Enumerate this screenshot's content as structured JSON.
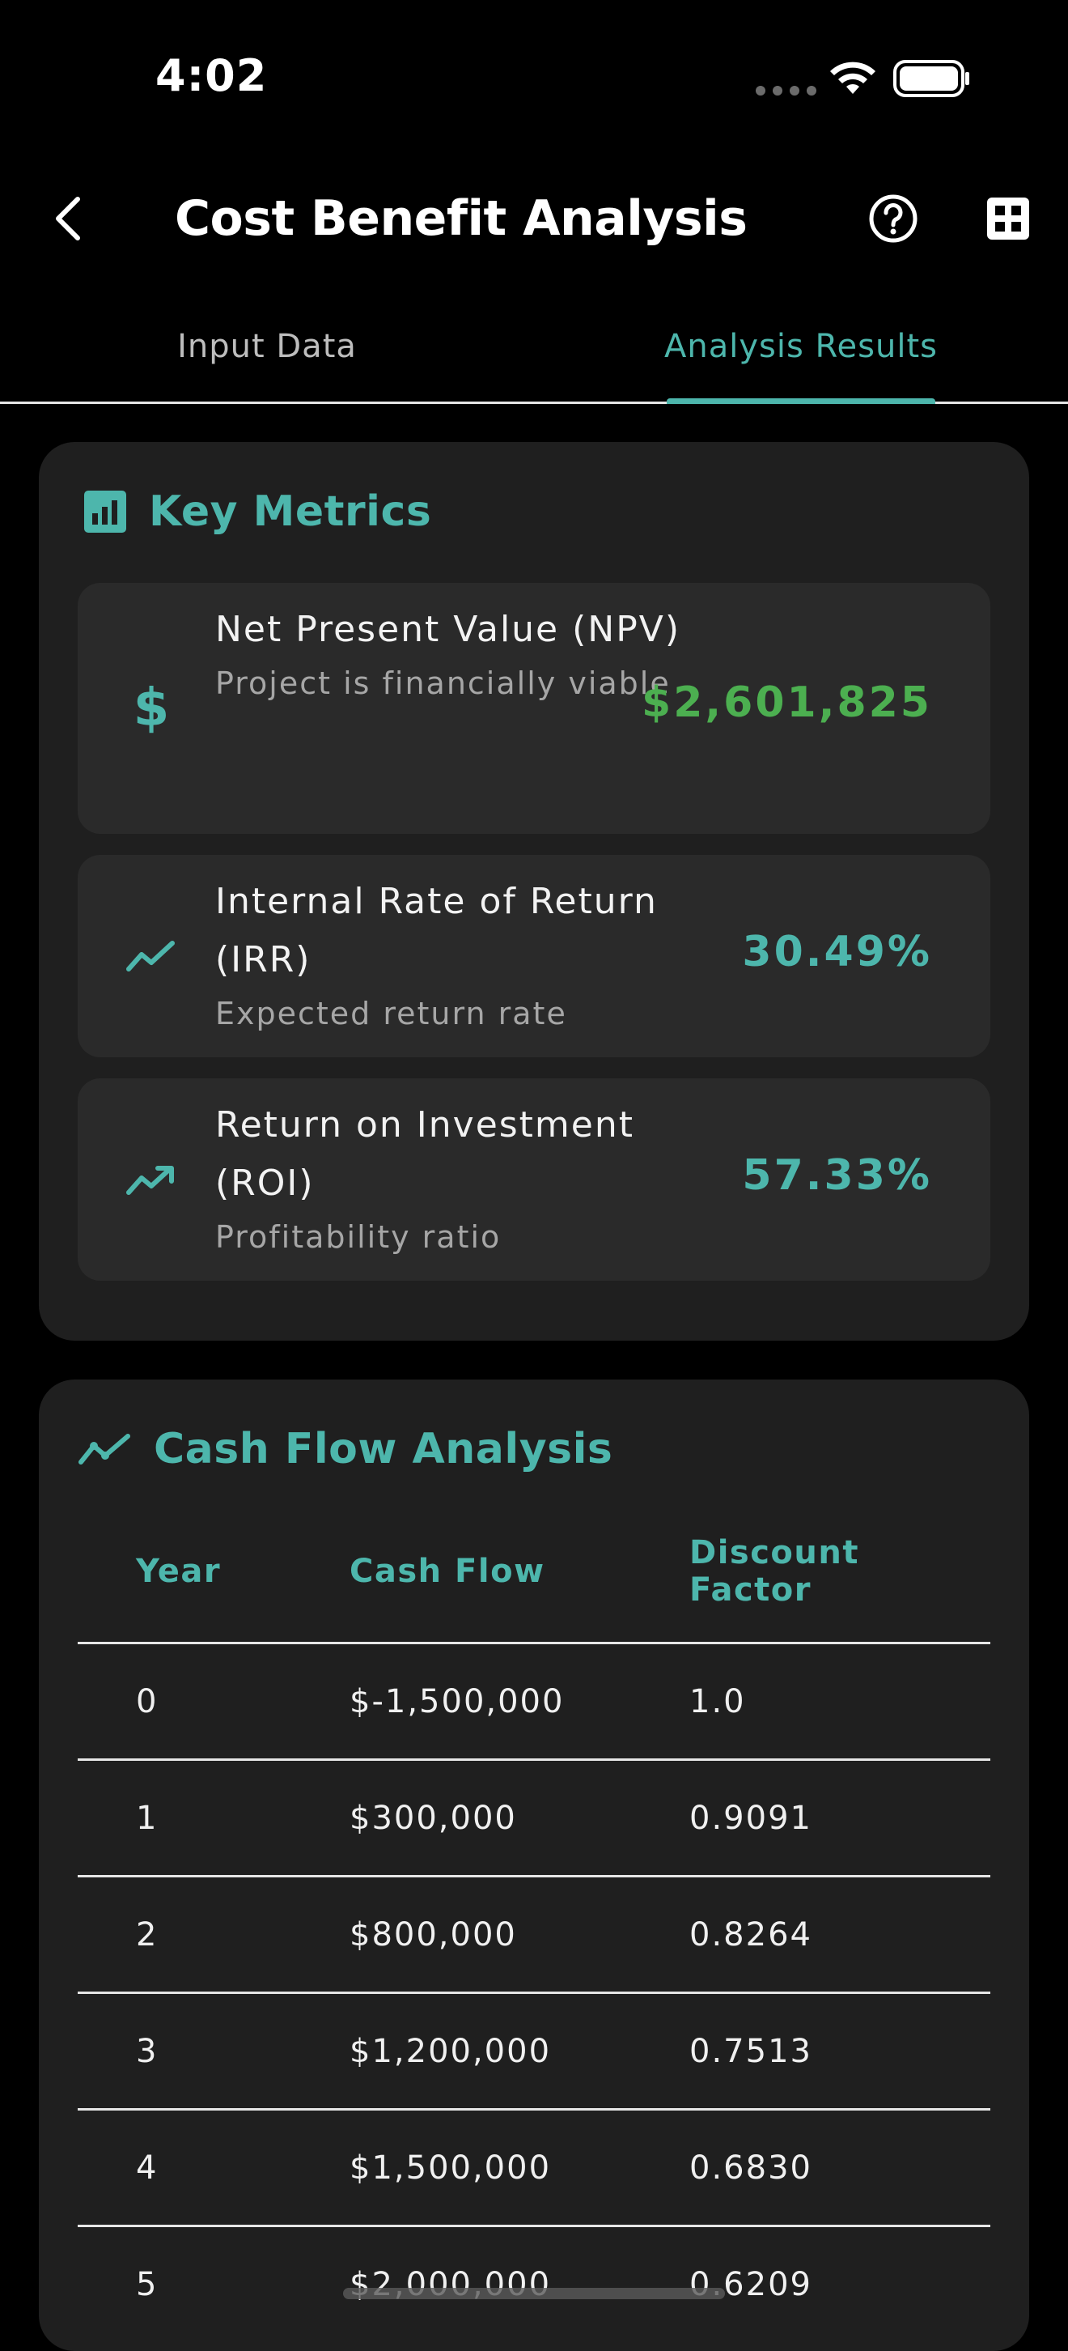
{
  "status_bar": {
    "time": "4:02"
  },
  "app_bar": {
    "title": "Cost Benefit Analysis"
  },
  "tabs": [
    {
      "label": "Input Data",
      "selected": false
    },
    {
      "label": "Analysis Results",
      "selected": true
    }
  ],
  "key_metrics": {
    "title": "Key Metrics",
    "items": [
      {
        "label": "Net Present Value (NPV)",
        "subtitle": "Project is financially viable",
        "value": "$2,601,825",
        "value_color": "#4caf50",
        "icon": "dollar-icon"
      },
      {
        "label": "Internal Rate of Return (IRR)",
        "subtitle": "Expected return rate",
        "value": "30.49%",
        "value_color": "#4db6ac",
        "icon": "trending-line-icon"
      },
      {
        "label": "Return on Investment (ROI)",
        "subtitle": "Profitability ratio",
        "value": "57.33%",
        "value_color": "#4db6ac",
        "icon": "trending-up-icon"
      }
    ]
  },
  "cash_flow": {
    "title": "Cash Flow Analysis",
    "columns": [
      "Year",
      "Cash Flow",
      "Discount Factor"
    ],
    "rows": [
      [
        "0",
        "$-1,500,000",
        "1.0"
      ],
      [
        "1",
        "$300,000",
        "0.9091"
      ],
      [
        "2",
        "$800,000",
        "0.8264"
      ],
      [
        "3",
        "$1,200,000",
        "0.7513"
      ],
      [
        "4",
        "$1,500,000",
        "0.6830"
      ],
      [
        "5",
        "$2,000,000",
        "0.6209"
      ]
    ]
  },
  "colors": {
    "accent": "#4db6ac",
    "positive": "#4caf50",
    "background": "#000000",
    "card": "#1f1f1f",
    "tile": "#2a2a2a"
  }
}
